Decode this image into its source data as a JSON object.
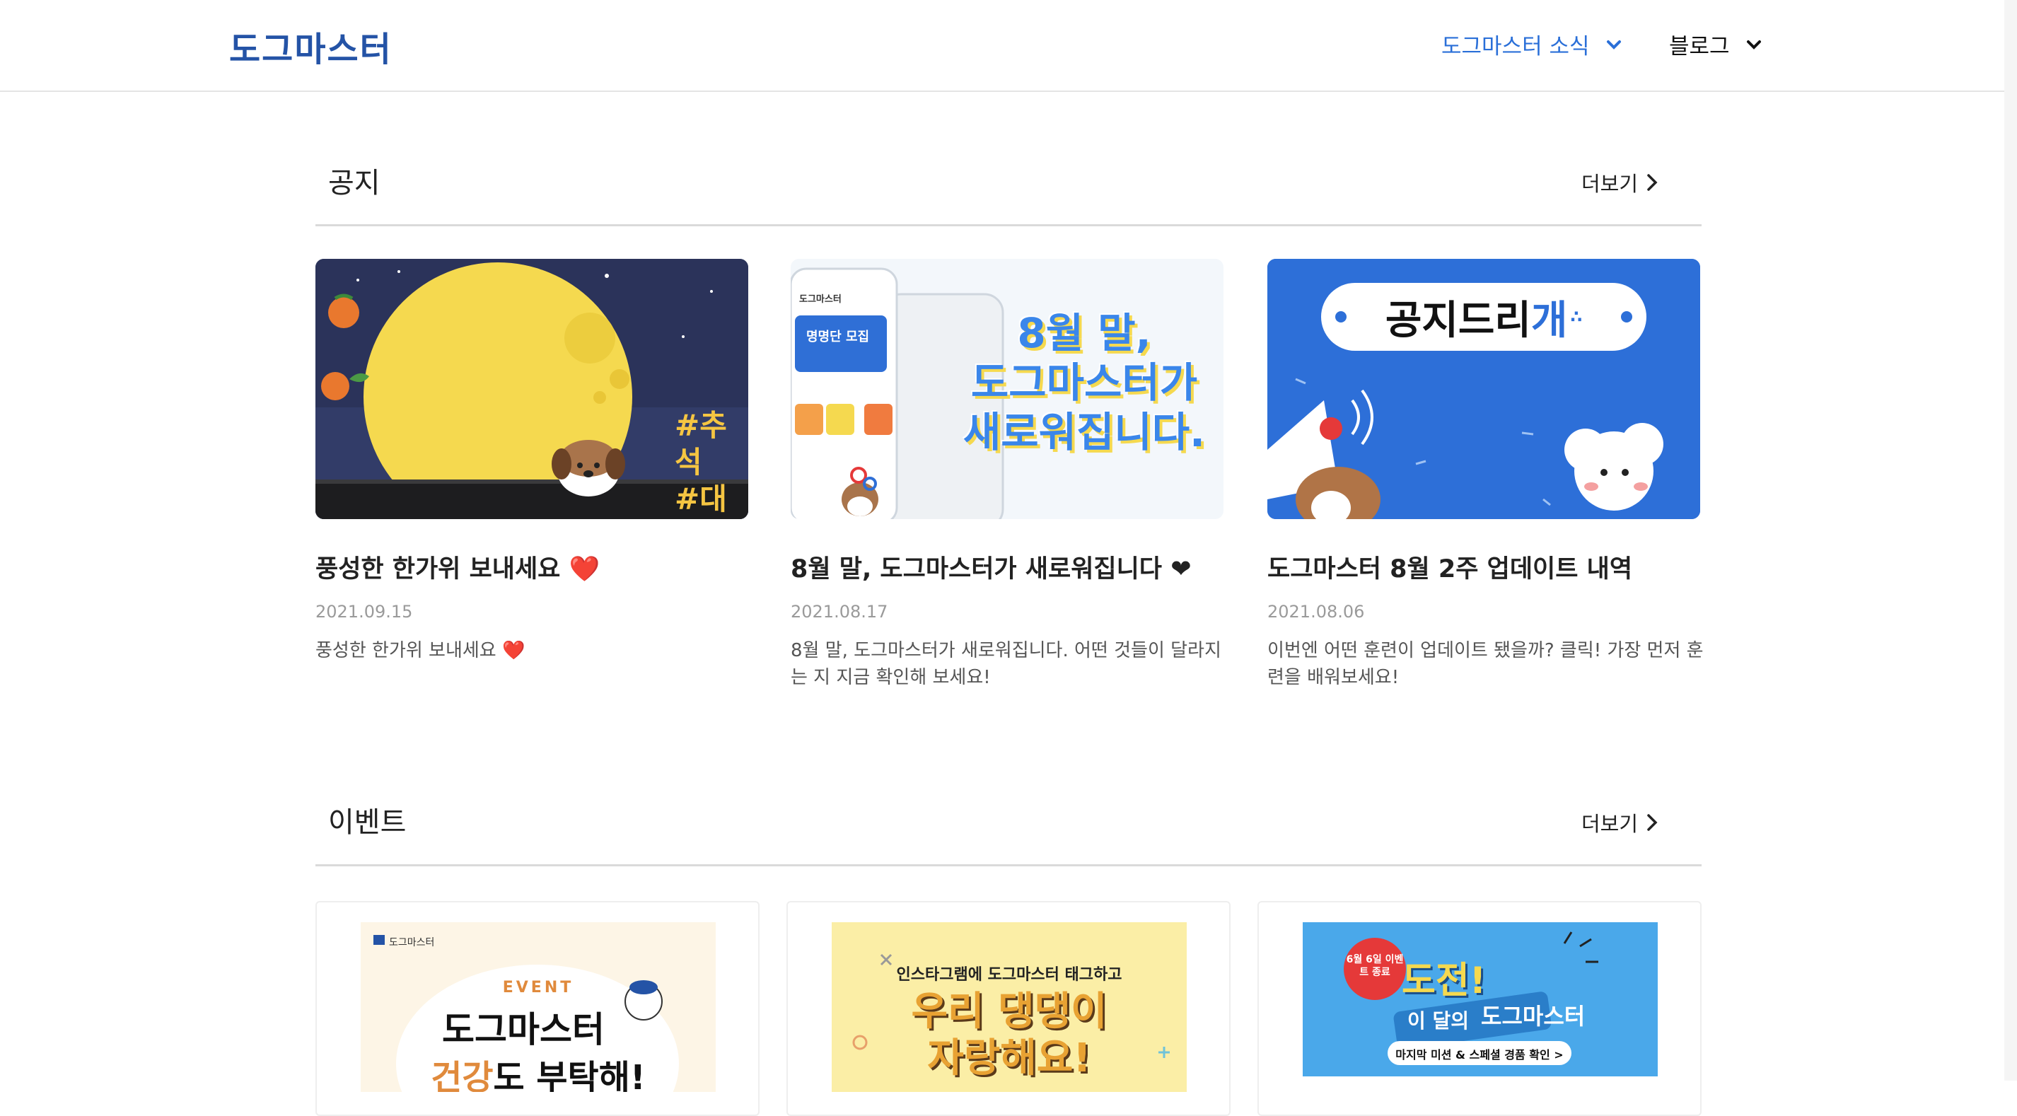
{
  "header": {
    "logo": "도그마스터",
    "nav": [
      {
        "label": "도그마스터 소식"
      },
      {
        "label": "블로그"
      }
    ]
  },
  "notice": {
    "title": "공지",
    "more": "더보기",
    "cards": [
      {
        "title": "풍성한 한가위 보내세요",
        "emoji": "❤️",
        "date": "2021.09.15",
        "desc": "풍성한 한가위 보내세요",
        "desc_emoji": "❤️",
        "image_text": [
          "#추석",
          "#대비"
        ]
      },
      {
        "title": "8월 말, 도그마스터가 새로워집니다",
        "emoji": "❤",
        "date": "2021.08.17",
        "desc": "8월 말, 도그마스터가 새로워집니다. 어떤 것들이 달라지는 지 지금 확인해 보세요!",
        "image_text": [
          "8월 말,",
          "도그마스터가",
          "새로워집니다."
        ],
        "phone_app_name": "도그마스터",
        "phone_banner": "명명단 모집"
      },
      {
        "title": "도그마스터 8월 2주 업데이트 내역",
        "date": "2021.08.06",
        "desc": "이번엔 어떤 훈련이 업데이트 됐을까? 클릭! 가장 먼저 훈련을 배워보세요!",
        "image_text": "공지드리",
        "image_text_accent": "개"
      }
    ]
  },
  "event": {
    "title": "이벤트",
    "more": "더보기",
    "cards": [
      {
        "brand": "도그마스터",
        "tag": "EVENT",
        "headline": "도그마스터",
        "sub_a": "건강",
        "sub_b": "도 부탁해!"
      },
      {
        "line1": "인스타그램에 도그마스터 태그하고",
        "headline1": "우리 댕댕이",
        "headline2": "자랑해요!"
      },
      {
        "badge": "6월 6일 이벤트 종료",
        "headline": "도전!",
        "sub1": "이 달의",
        "sub2": "도그마스터",
        "cta": "마지막 미션 & 스페셜 경품 확인 >"
      }
    ]
  },
  "colors": {
    "brand": "#2453a6",
    "nav_active": "#2a6fd8",
    "heart": "#e23b3b"
  }
}
